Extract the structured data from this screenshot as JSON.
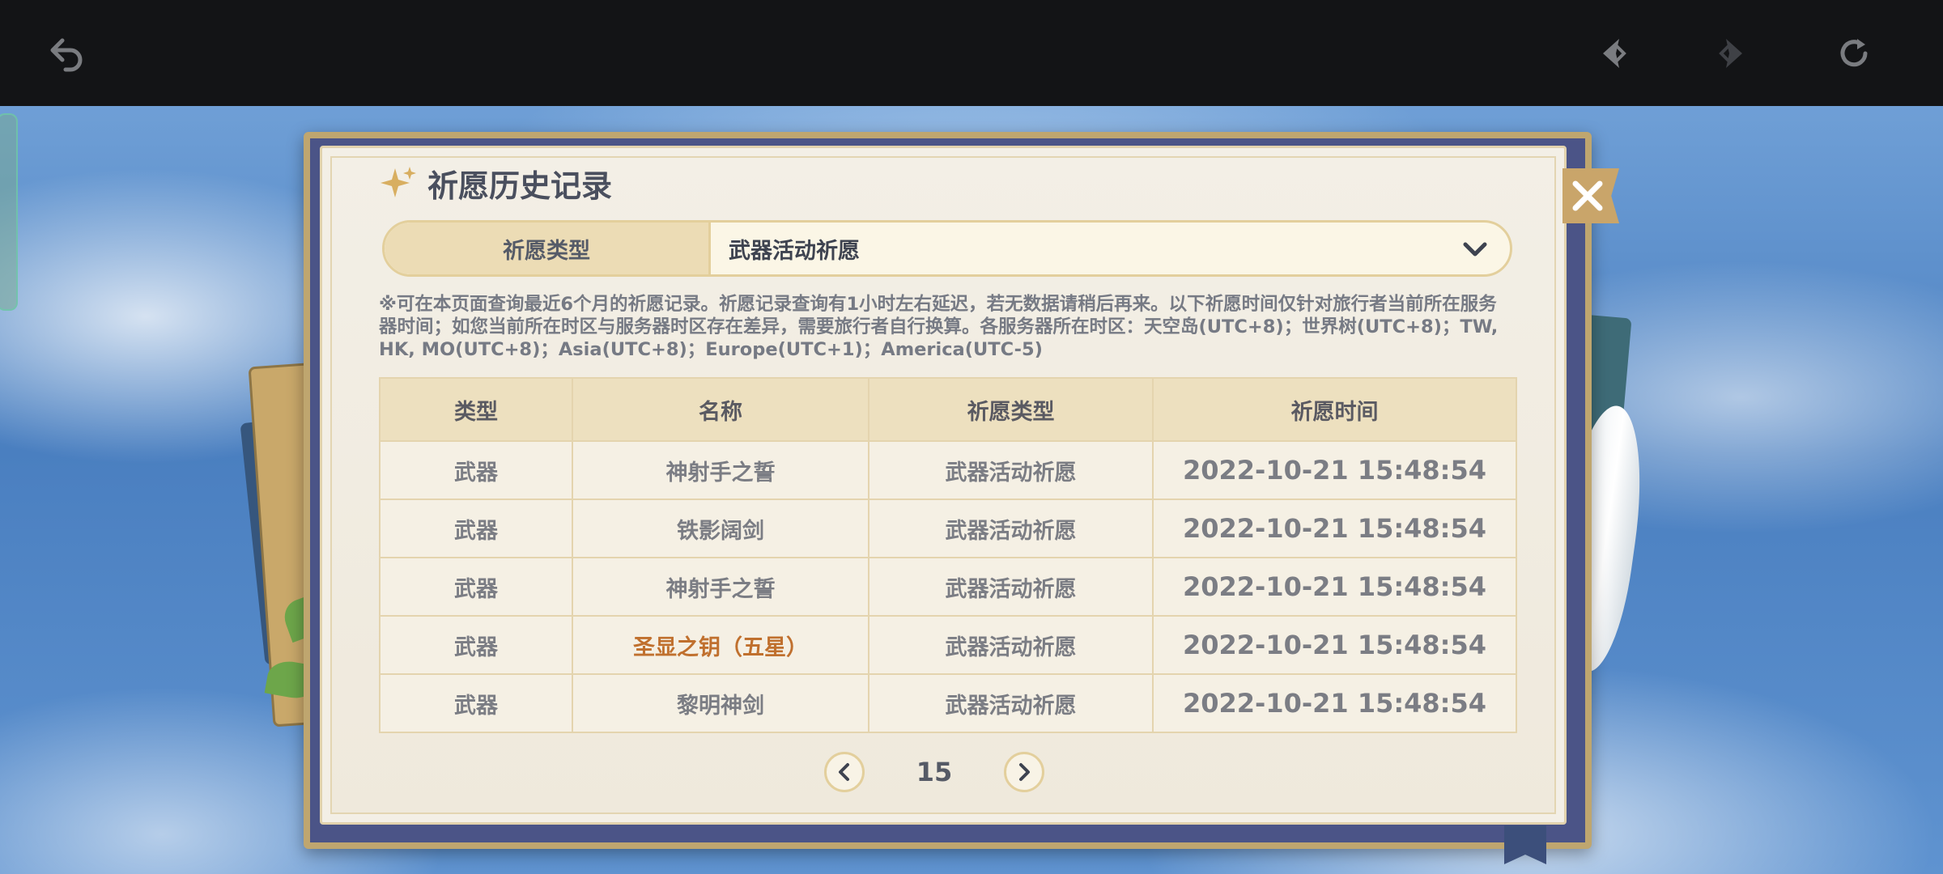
{
  "topbar": {
    "back_icon": "undo-arrow-icon",
    "prev_icon": "diamond-left-icon",
    "next_icon": "diamond-right-icon",
    "refresh_icon": "refresh-icon"
  },
  "dialog": {
    "title": "祈愿历史记录",
    "filter": {
      "label": "祈愿类型",
      "selected": "武器活动祈愿"
    },
    "notice": "※可在本页面查询最近6个月的祈愿记录。祈愿记录查询有1小时左右延迟，若无数据请稍后再来。以下祈愿时间仅针对旅行者当前所在服务器时间；如您当前所在时区与服务器时区存在差异，需要旅行者自行换算。各服务器所在时区：天空岛(UTC+8)；世界树(UTC+8)；TW, HK, MO(UTC+8)；Asia(UTC+8)；Europe(UTC+1)；America(UTC-5)",
    "table": {
      "headers": [
        "类型",
        "名称",
        "祈愿类型",
        "祈愿时间"
      ],
      "rows": [
        [
          "武器",
          "神射手之誓",
          "武器活动祈愿",
          "2022-10-21 15:48:54"
        ],
        [
          "武器",
          "铁影阔剑",
          "武器活动祈愿",
          "2022-10-21 15:48:54"
        ],
        [
          "武器",
          "神射手之誓",
          "武器活动祈愿",
          "2022-10-21 15:48:54"
        ],
        [
          "武器",
          "圣显之钥（五星）",
          "武器活动祈愿",
          "2022-10-21 15:48:54"
        ],
        [
          "武器",
          "黎明神剑",
          "武器活动祈愿",
          "2022-10-21 15:48:54"
        ]
      ]
    },
    "pagination": {
      "page": "15"
    }
  },
  "colors": {
    "five_star": "#c0702e",
    "header_bg": "#ede0bf",
    "title": "#4a4f5e"
  }
}
